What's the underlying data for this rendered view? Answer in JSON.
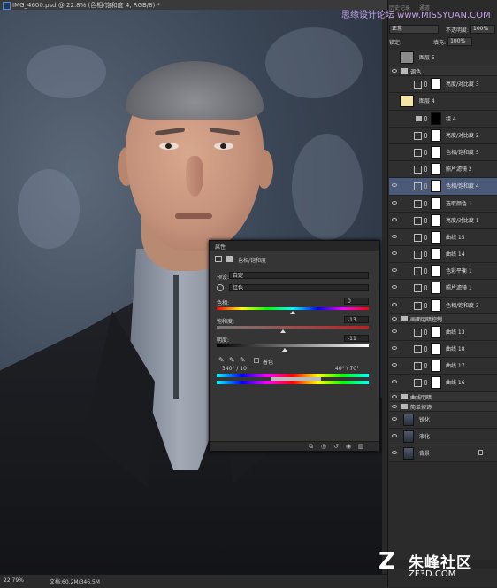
{
  "document": {
    "tab_title": "IMG_4600.psd @ 22.8% (色相/饱和度 4, RGB/8) *"
  },
  "watermark_top": "思缘设计论坛 www.MISSYUAN.COM",
  "watermark_logo": {
    "cn": "朱峰社区",
    "en": "ZF3D.COM"
  },
  "status_bar": {
    "zoom": "22.79%",
    "doc_info": "文档:60.2M/346.5M"
  },
  "panel_tabs": [
    "历史记录",
    "通道"
  ],
  "layers_panel": {
    "blend_mode": "正常",
    "opacity_label": "不透明度:",
    "opacity_value": "100%",
    "lock_label": "锁定:",
    "fill_label": "填充:",
    "fill_value": "100%"
  },
  "layers": [
    {
      "name": "图层 5",
      "kind": "pixel-gray",
      "visible": false
    },
    {
      "name": "调色",
      "kind": "group",
      "visible": true
    },
    {
      "name": "亮度/对比度 3",
      "kind": "adjustment",
      "icon": "sun-icon",
      "visible": false
    },
    {
      "name": "图层 4",
      "kind": "pixel-yellow",
      "visible": false
    },
    {
      "name": "组 4",
      "kind": "group-item",
      "visible": false
    },
    {
      "name": "亮度/对比度 2",
      "kind": "adjustment",
      "icon": "sun-icon",
      "visible": false
    },
    {
      "name": "色相/饱和度 5",
      "kind": "adjustment",
      "icon": "hue-sat-icon",
      "visible": false
    },
    {
      "name": "照片滤镜 2",
      "kind": "adjustment",
      "icon": "camera-icon",
      "visible": false
    },
    {
      "name": "色相/饱和度 4",
      "kind": "adjustment",
      "icon": "hue-sat-icon",
      "visible": true,
      "selected": true
    },
    {
      "name": "选取颜色 1",
      "kind": "adjustment",
      "icon": "selective-color-icon",
      "visible": true
    },
    {
      "name": "亮度/对比度 1",
      "kind": "adjustment",
      "icon": "sun-icon",
      "visible": true
    },
    {
      "name": "曲线 15",
      "kind": "adjustment",
      "icon": "curves-icon",
      "visible": true
    },
    {
      "name": "曲线 14",
      "kind": "adjustment",
      "icon": "curves-icon",
      "visible": true
    },
    {
      "name": "色彩平衡 1",
      "kind": "adjustment",
      "icon": "balance-icon",
      "visible": true
    },
    {
      "name": "照片滤镜 1",
      "kind": "adjustment",
      "icon": "camera-icon",
      "visible": true
    },
    {
      "name": "色相/饱和度 3",
      "kind": "adjustment",
      "icon": "hue-sat-icon",
      "visible": true
    },
    {
      "name": "画面明暗控制",
      "kind": "group",
      "visible": true
    },
    {
      "name": "曲线 13",
      "kind": "adjustment",
      "icon": "curves-icon",
      "visible": true
    },
    {
      "name": "曲线 18",
      "kind": "adjustment",
      "icon": "curves-icon",
      "visible": true
    },
    {
      "name": "曲线 17",
      "kind": "adjustment",
      "icon": "curves-icon",
      "visible": true
    },
    {
      "name": "曲线 16",
      "kind": "adjustment",
      "icon": "curves-icon",
      "visible": true
    },
    {
      "name": "曲线明暗",
      "kind": "group",
      "visible": true
    },
    {
      "name": "简单修饰",
      "kind": "group",
      "visible": true
    },
    {
      "name": "锐化",
      "kind": "pixel-face",
      "visible": true
    },
    {
      "name": "液化",
      "kind": "pixel-face",
      "visible": true
    },
    {
      "name": "背景",
      "kind": "pixel-face",
      "visible": true,
      "locked": true
    }
  ],
  "properties_panel": {
    "title": "属性",
    "adjustment_name": "色相/饱和度",
    "preset_label": "预设:",
    "preset_value": "自定",
    "channel_value": "红色",
    "hue_label": "色相:",
    "hue_value": "0",
    "hue_level": 0.5,
    "saturation_label": "饱和度:",
    "saturation_value": "-13",
    "saturation_level": 0.435,
    "lightness_label": "明度:",
    "lightness_value": "-11",
    "lightness_level": 0.445,
    "colorize_label": "着色",
    "range_left": "340° / 10°",
    "range_right": "40° \\ 70°"
  }
}
